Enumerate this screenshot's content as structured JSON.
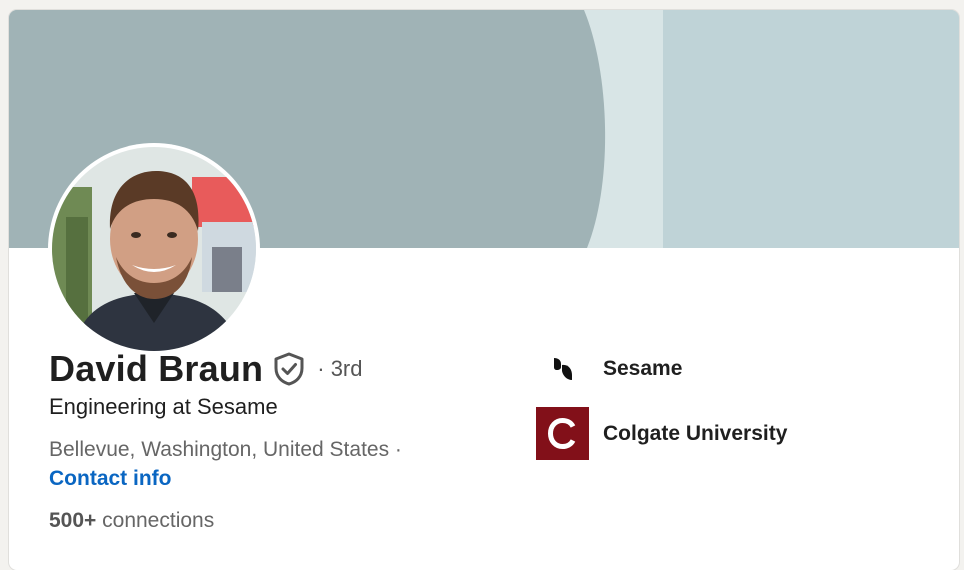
{
  "profile": {
    "name": "David Braun",
    "degree": "· 3rd",
    "headline": "Engineering at Sesame",
    "location": "Bellevue, Washington, United States ·",
    "contact_label": "Contact info",
    "connections_count": "500+",
    "connections_label": " connections"
  },
  "organizations": [
    {
      "name": "Sesame",
      "logo_icon": "sesame-logo-icon"
    },
    {
      "name": "Colgate University",
      "logo_icon": "colgate-logo-icon",
      "logo_color": "#821019"
    }
  ],
  "colors": {
    "link": "#0a66c2",
    "banner_dark": "#a0b3b6",
    "banner_mid": "#d8e5e6",
    "banner_light": "#bfd3d7"
  }
}
